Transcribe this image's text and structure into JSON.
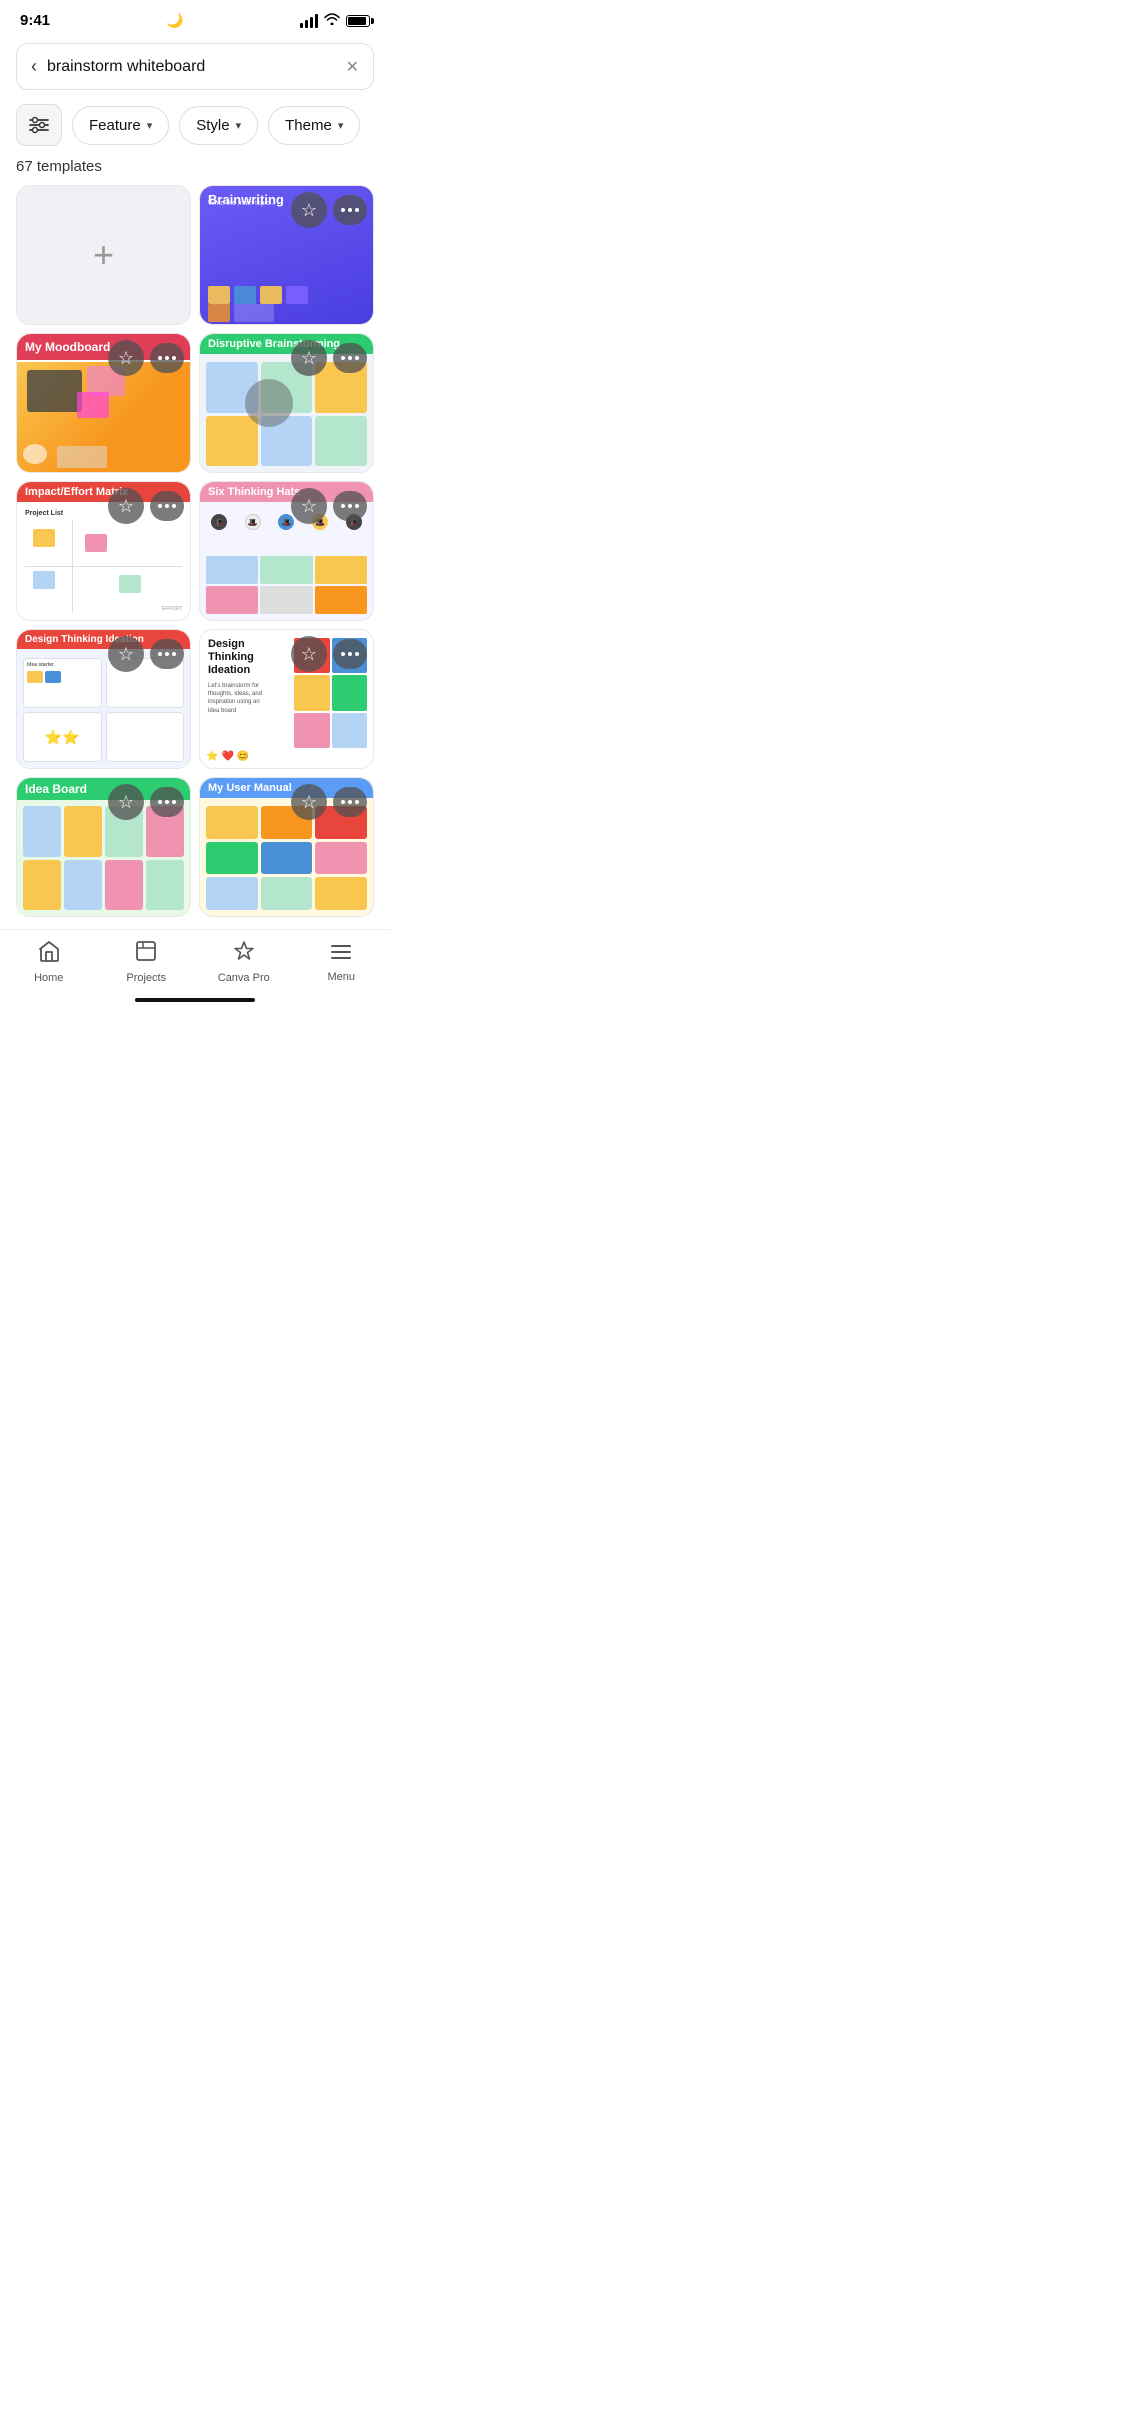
{
  "status": {
    "time": "9:41",
    "moon": "🌙"
  },
  "search": {
    "query": "brainstorm whiteboard",
    "placeholder": "brainstorm whiteboard"
  },
  "filters": {
    "icon_label": "⚙",
    "buttons": [
      {
        "label": "Feature",
        "id": "feature"
      },
      {
        "label": "Style",
        "id": "style"
      },
      {
        "label": "Theme",
        "id": "theme"
      }
    ]
  },
  "template_count": "67 templates",
  "templates": [
    {
      "id": "add-new",
      "type": "add"
    },
    {
      "id": "brainwriting",
      "title": "Brainwriting",
      "type": "brainwriting"
    },
    {
      "id": "moodboard",
      "title": "My Moodboard",
      "type": "moodboard"
    },
    {
      "id": "disruptive",
      "title": "Disruptive Brainstorming",
      "type": "disruptive"
    },
    {
      "id": "impact-matrix",
      "title": "Impact/Effort Matrix",
      "type": "impact"
    },
    {
      "id": "six-hats",
      "title": "Six Thinking Hats",
      "type": "six"
    },
    {
      "id": "dt-ideation-1",
      "title": "Design Thinking Ideation",
      "type": "dt1"
    },
    {
      "id": "dt-ideation-2",
      "title": "Design Thinking Ideation",
      "type": "dt2"
    },
    {
      "id": "idea-board",
      "title": "Idea Board",
      "type": "idea"
    },
    {
      "id": "user-manual",
      "title": "My User Manual",
      "type": "user"
    }
  ],
  "nav": {
    "items": [
      {
        "id": "home",
        "label": "Home",
        "icon": "⌂"
      },
      {
        "id": "projects",
        "label": "Projects",
        "icon": "□"
      },
      {
        "id": "canva-pro",
        "label": "Canva Pro",
        "icon": "♛"
      },
      {
        "id": "menu",
        "label": "Menu",
        "icon": "≡"
      }
    ]
  },
  "colors": {
    "brainwriting_bg": "#5b4cee",
    "moodboard_title": "#e03e56",
    "disruptive_title": "#2ecc71",
    "impact_title": "#e8453c",
    "six_title": "#f093b0",
    "dt1_title": "#e8453c",
    "idea_title": "#2ecc71",
    "user_title": "#5b9cf6"
  }
}
